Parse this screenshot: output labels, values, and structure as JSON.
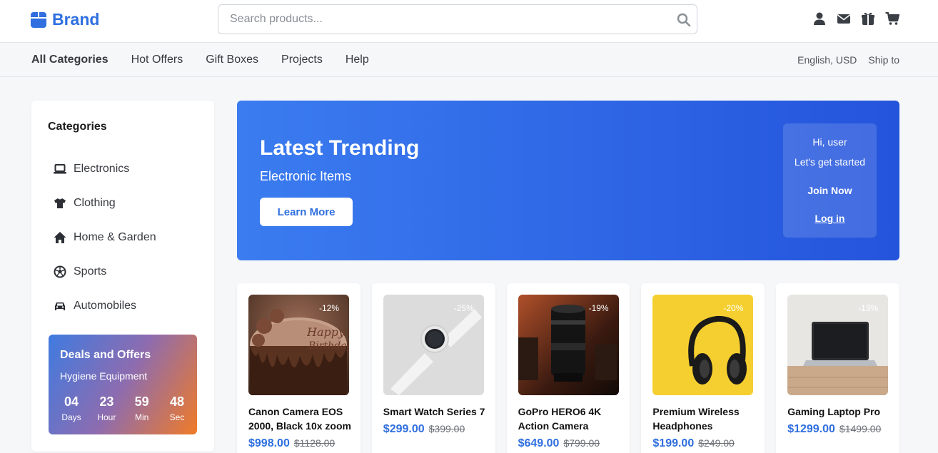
{
  "header": {
    "brand": "Brand",
    "search_placeholder": "Search products...",
    "icons": [
      "user-icon",
      "mail-icon",
      "gift-icon",
      "cart-icon"
    ],
    "accent_color": "#2f6fdf"
  },
  "nav": {
    "links": [
      "All Categories",
      "Hot Offers",
      "Gift Boxes",
      "Projects",
      "Help"
    ],
    "active": "All Categories",
    "right": [
      "English, USD",
      "Ship to"
    ]
  },
  "sidebar": {
    "title": "Categories",
    "items": [
      {
        "label": "Electronics",
        "icon": "laptop-icon"
      },
      {
        "label": "Clothing",
        "icon": "shirt-icon"
      },
      {
        "label": "Home & Garden",
        "icon": "home-icon"
      },
      {
        "label": "Sports",
        "icon": "ball-icon"
      },
      {
        "label": "Automobiles",
        "icon": "car-icon"
      }
    ],
    "deals": {
      "title": "Deals and Offers",
      "subtitle": "Hygiene Equipment",
      "countdown": [
        {
          "value": "04",
          "label": "Days"
        },
        {
          "value": "23",
          "label": "Hour"
        },
        {
          "value": "59",
          "label": "Min"
        },
        {
          "value": "48",
          "label": "Sec"
        }
      ]
    }
  },
  "banner": {
    "title": "Latest Trending",
    "subtitle": "Electronic Items",
    "button": "Learn More",
    "user_box": {
      "greeting": "Hi, user",
      "prompt": "Let's get started",
      "join": "Join Now",
      "login": "Log in"
    }
  },
  "products": [
    {
      "name": "Canon Camera EOS 2000, Black 10x zoom",
      "price": "$998.00",
      "old_price": "$1128.00",
      "discount": "-12%",
      "image": "birthday-cake"
    },
    {
      "name": "Smart Watch Series 7",
      "price": "$299.00",
      "old_price": "$399.00",
      "discount": "-25%",
      "image": "smart-watch"
    },
    {
      "name": "GoPro HERO6 4K Action Camera",
      "price": "$649.00",
      "old_price": "$799.00",
      "discount": "-19%",
      "image": "camera-lens"
    },
    {
      "name": "Premium Wireless Headphones",
      "price": "$199.00",
      "old_price": "$249.00",
      "discount": "-20%",
      "image": "headphones"
    },
    {
      "name": "Gaming Laptop Pro",
      "price": "$1299.00",
      "old_price": "$1499.00",
      "discount": "-13%",
      "image": "laptop"
    }
  ]
}
